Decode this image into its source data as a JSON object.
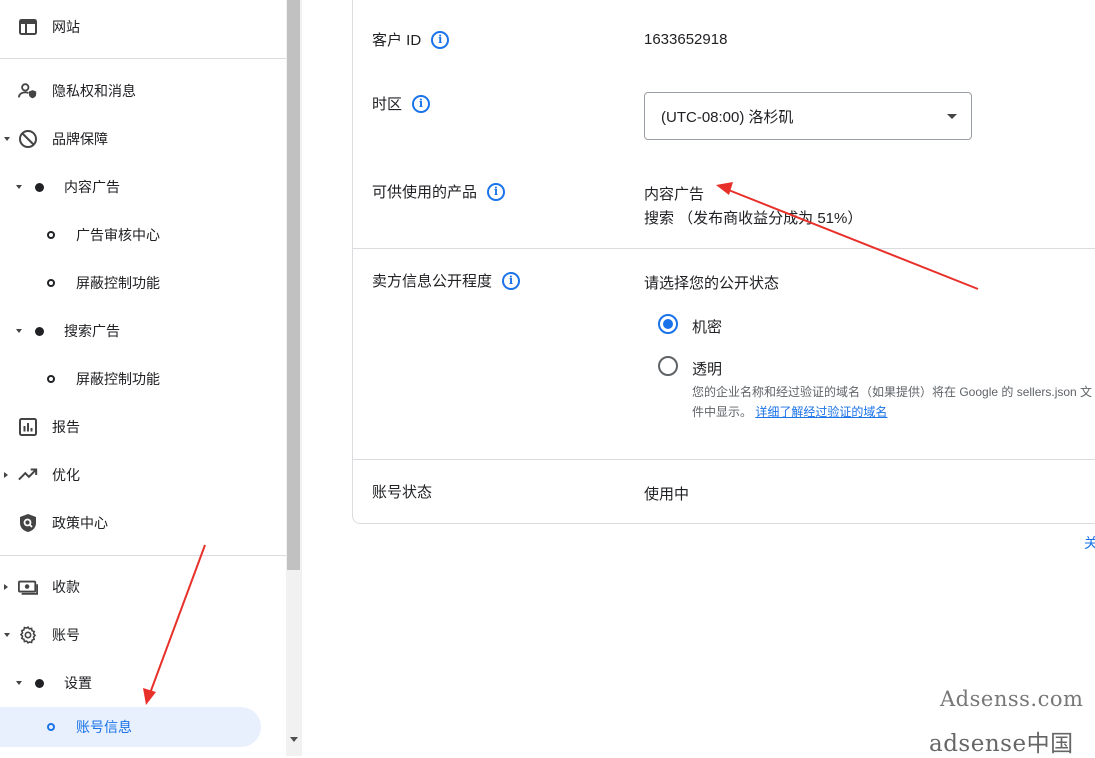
{
  "sidebar": {
    "top_item": {
      "label": "网站",
      "icon": "web-icon"
    },
    "items": [
      {
        "label": "隐私权和消息",
        "icon": "privacy-person-icon"
      },
      {
        "label": "品牌保障",
        "icon": "block-icon"
      },
      {
        "label": "内容广告"
      },
      {
        "label": "广告审核中心"
      },
      {
        "label": "屏蔽控制功能"
      },
      {
        "label": "搜索广告"
      },
      {
        "label": "屏蔽控制功能"
      },
      {
        "label": "报告",
        "icon": "bar-chart-icon"
      },
      {
        "label": "优化",
        "icon": "trending-up-icon"
      },
      {
        "label": "政策中心",
        "icon": "policy-shield-icon"
      },
      {
        "label": "收款",
        "icon": "payments-icon"
      },
      {
        "label": "账号",
        "icon": "settings-gear-icon"
      },
      {
        "label": "设置"
      },
      {
        "label": "账号信息"
      }
    ]
  },
  "account": {
    "customer_id_label": "客户 ID",
    "customer_id_value": "1633652918",
    "timezone_label": "时区",
    "timezone_value": "(UTC-08:00) 洛杉矶",
    "products_label": "可供使用的产品",
    "products": [
      "内容广告",
      "搜索 （发布商收益分成为 51%）"
    ],
    "seller_label": "卖方信息公开程度",
    "seller_prompt": "请选择您的公开状态",
    "seller_options": [
      {
        "label": "机密",
        "checked": true
      },
      {
        "label": "透明",
        "checked": false
      }
    ],
    "seller_help": "您的企业名称和经过验证的域名（如果提供）将在 Google 的 sellers.json 文件中显示。",
    "seller_help_link": "详细了解经过验证的域名",
    "status_label": "账号状态",
    "status_value": "使用中",
    "edge_link": "关"
  },
  "watermarks": [
    "Adsenss.com",
    "adsense中国"
  ],
  "colors": {
    "accent": "#1a73e8",
    "annotation_arrow": "#e8302a",
    "active_bg": "#e8f0fe"
  }
}
